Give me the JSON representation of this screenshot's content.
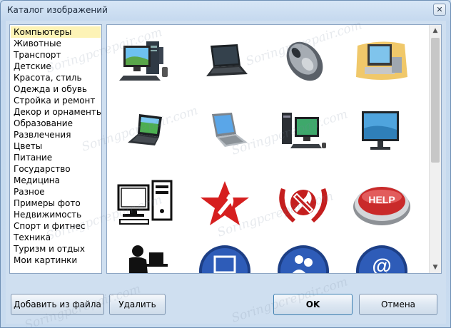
{
  "window": {
    "title": "Каталог изображений",
    "close_glyph": "✕"
  },
  "categories": [
    {
      "label": "Компьютеры",
      "selected": true
    },
    {
      "label": "Животные"
    },
    {
      "label": "Транспорт"
    },
    {
      "label": "Детские"
    },
    {
      "label": "Красота, стиль"
    },
    {
      "label": "Одежда и обувь"
    },
    {
      "label": "Стройка и ремонт"
    },
    {
      "label": "Декор и орнаменты"
    },
    {
      "label": "Образование"
    },
    {
      "label": "Развлечения"
    },
    {
      "label": "Цветы"
    },
    {
      "label": "Питание"
    },
    {
      "label": "Государство"
    },
    {
      "label": "Медицина"
    },
    {
      "label": "Разное"
    },
    {
      "label": "Примеры фото"
    },
    {
      "label": "Недвижимость"
    },
    {
      "label": "Спорт и фитнес"
    },
    {
      "label": "Техника"
    },
    {
      "label": "Туризм и отдых"
    },
    {
      "label": "Мои картинки"
    }
  ],
  "gallery": {
    "thumbnails": [
      {
        "icon": "desktop-computer-icon"
      },
      {
        "icon": "laptop-icon"
      },
      {
        "icon": "computer-mouse-icon"
      },
      {
        "icon": "vintage-computer-icon"
      },
      {
        "icon": "open-laptop-icon"
      },
      {
        "icon": "laptop-grey-icon"
      },
      {
        "icon": "desktop-system-icon"
      },
      {
        "icon": "lcd-monitor-icon"
      },
      {
        "icon": "computer-sketch-icon"
      },
      {
        "icon": "red-star-emblem-icon"
      },
      {
        "icon": "wreath-emblem-icon"
      },
      {
        "icon": "help-button-icon"
      },
      {
        "icon": "user-at-desk-icon"
      },
      {
        "icon": "blue-window-button-icon"
      },
      {
        "icon": "blue-users-button-icon"
      },
      {
        "icon": "blue-at-button-icon"
      }
    ],
    "help_label": "HELP",
    "at_glyph": "@",
    "scroll_up_glyph": "▲",
    "scroll_down_glyph": "▼"
  },
  "buttons": {
    "add_from_file": "Добавить из файла",
    "delete": "Удалить",
    "ok": "OK",
    "cancel": "Отмена"
  },
  "watermark": "Soringpcrepair.com"
}
